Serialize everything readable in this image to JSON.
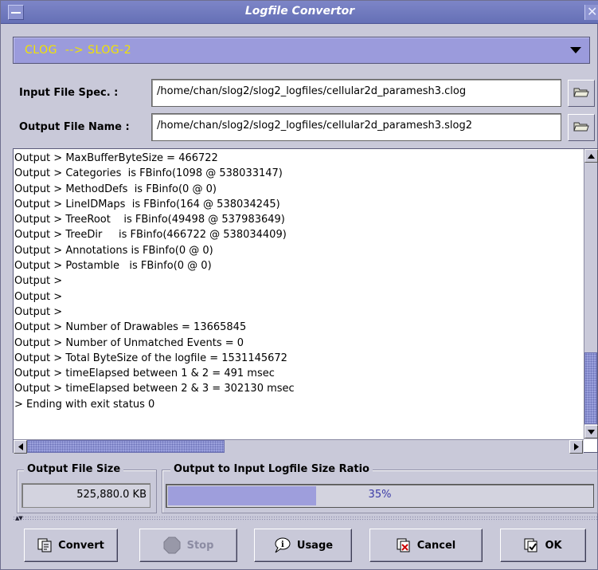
{
  "window": {
    "title": "Logfile Convertor"
  },
  "converter": {
    "selected": "CLOG  --> SLOG-2"
  },
  "input_file": {
    "label": "Input File Spec. :",
    "value": "/home/chan/slog2/slog2_logfiles/cellular2d_paramesh3.clog"
  },
  "output_file": {
    "label": "Output File Name :",
    "value": "/home/chan/slog2/slog2_logfiles/cellular2d_paramesh3.slog2"
  },
  "log": {
    "lines": [
      "Output > MaxBufferByteSize = 466722",
      "Output > Categories  is FBinfo(1098 @ 538033147)",
      "Output > MethodDefs  is FBinfo(0 @ 0)",
      "Output > LineIDMaps  is FBinfo(164 @ 538034245)",
      "Output > TreeRoot    is FBinfo(49498 @ 537983649)",
      "Output > TreeDir     is FBinfo(466722 @ 538034409)",
      "Output > Annotations is FBinfo(0 @ 0)",
      "Output > Postamble   is FBinfo(0 @ 0)",
      "Output >",
      "Output >",
      "Output >",
      "Output > Number of Drawables = 13665845",
      "Output > Number of Unmatched Events = 0",
      "Output > Total ByteSize of the logfile = 1531145672",
      "Output > timeElapsed between 1 & 2 = 491 msec",
      "Output > timeElapsed between 2 & 3 = 302130 msec",
      "> Ending with exit status 0"
    ]
  },
  "output_size": {
    "title": "Output File Size",
    "value": "525,880.0 KB"
  },
  "ratio": {
    "title": "Output to Input Logfile Size Ratio",
    "text": "35%",
    "fraction": 0.35
  },
  "buttons": {
    "convert": "Convert",
    "stop": "Stop",
    "usage": "Usage",
    "cancel": "Cancel",
    "ok": "OK"
  },
  "colors": {
    "titlebar": "#6a74ba",
    "combo_bg": "#9b9bdc",
    "combo_text": "#f2e300",
    "progress_fill": "#9e9edc",
    "progress_text": "#3b3ba7"
  },
  "icons": [
    "window-menu-icon",
    "close-icon",
    "chevron-down-icon",
    "folder-open-icon",
    "convert-icon",
    "stop-icon",
    "usage-icon",
    "cancel-icon",
    "ok-icon"
  ]
}
